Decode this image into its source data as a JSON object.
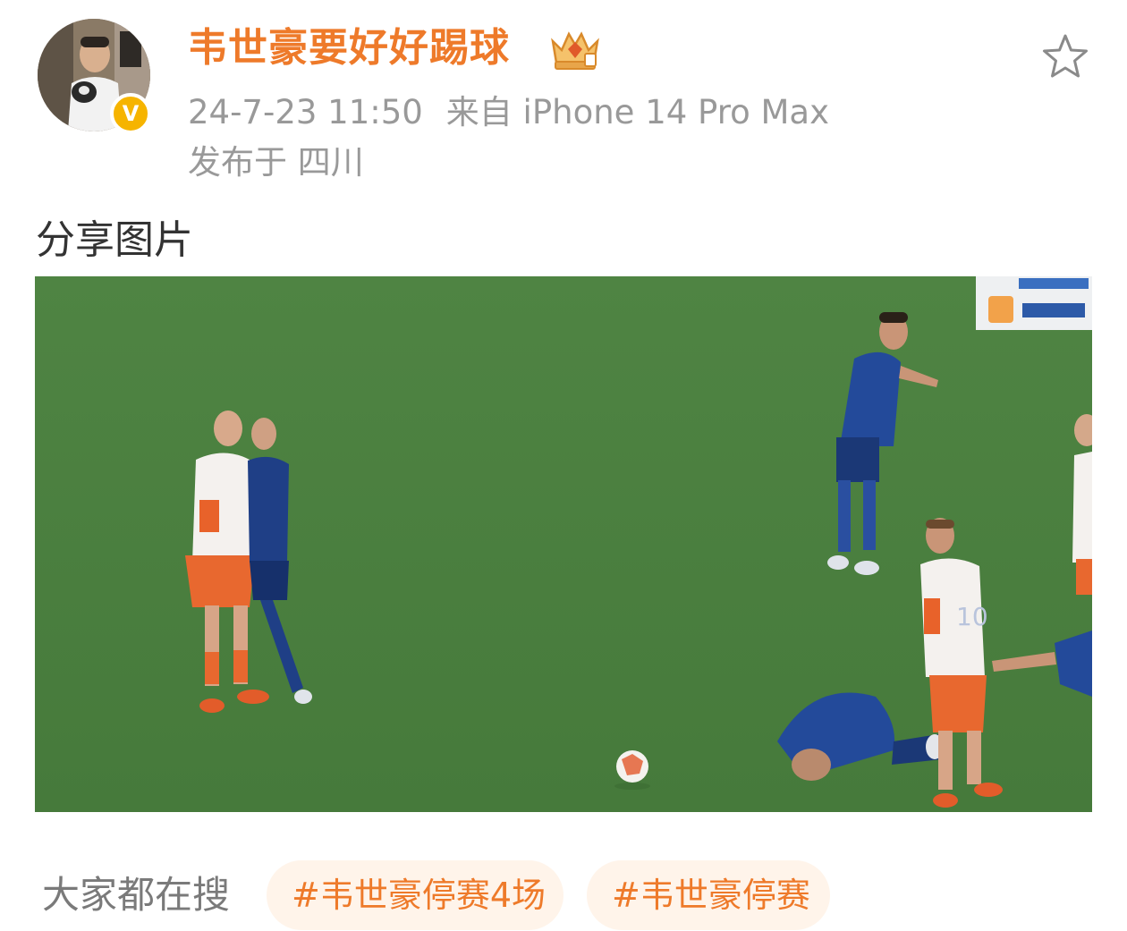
{
  "post": {
    "author": {
      "name": "韦世豪要好好踢球",
      "avatar_icon": "user-avatar-photo",
      "verified_icon": "verified-v-badge",
      "verified_mark": "V",
      "vip_icon": "vip-crown-icon"
    },
    "timestamp": "24-7-23 11:50",
    "source": "来自 iPhone 14 Pro Max",
    "location": "发布于 四川",
    "favorite_icon": "star-icon",
    "text": "分享图片",
    "image": {
      "description_icon": "football-match-photo"
    }
  },
  "trending": {
    "label": "大家都在搜",
    "tags": [
      {
        "text": "#韦世豪停赛4场"
      },
      {
        "text": "#韦世豪停赛"
      }
    ]
  },
  "colors": {
    "accent": "#ee7a2a",
    "meta": "#999999",
    "pill_bg": "#fff4ea",
    "verified": "#f6b400",
    "pitch": "#497e3f"
  }
}
